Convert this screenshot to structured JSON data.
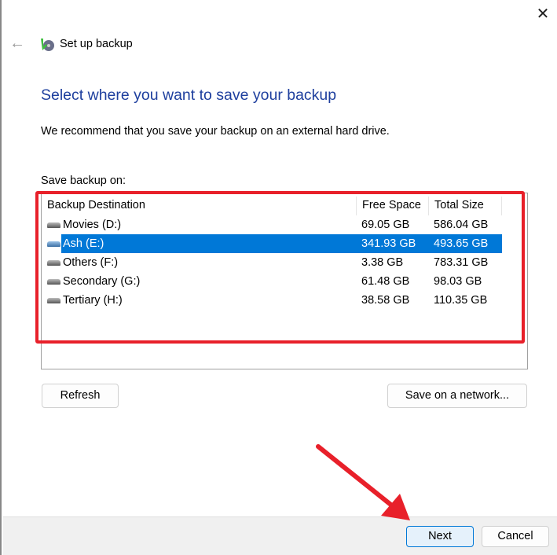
{
  "window": {
    "title": "Set up backup",
    "close_icon": "close-icon",
    "back_icon": "back-arrow-icon"
  },
  "heading": "Select where you want to save your backup",
  "description": "We recommend that you save your backup on an external hard drive.",
  "list_label": "Save backup on:",
  "table": {
    "columns": [
      "Backup Destination",
      "Free Space",
      "Total Size"
    ],
    "rows": [
      {
        "name": "Movies (D:)",
        "free": "69.05 GB",
        "total": "586.04 GB",
        "selected": false
      },
      {
        "name": "Ash (E:)",
        "free": "341.93 GB",
        "total": "493.65 GB",
        "selected": true
      },
      {
        "name": "Others (F:)",
        "free": "3.38 GB",
        "total": "783.31 GB",
        "selected": false
      },
      {
        "name": "Secondary (G:)",
        "free": "61.48 GB",
        "total": "98.03 GB",
        "selected": false
      },
      {
        "name": "Tertiary (H:)",
        "free": "38.58 GB",
        "total": "110.35 GB",
        "selected": false
      }
    ]
  },
  "buttons": {
    "refresh": "Refresh",
    "save_network": "Save on a network...",
    "next": "Next",
    "cancel": "Cancel"
  },
  "colors": {
    "heading": "#1e3f9e",
    "selection": "#0078d7",
    "annotation": "#e8202a"
  }
}
